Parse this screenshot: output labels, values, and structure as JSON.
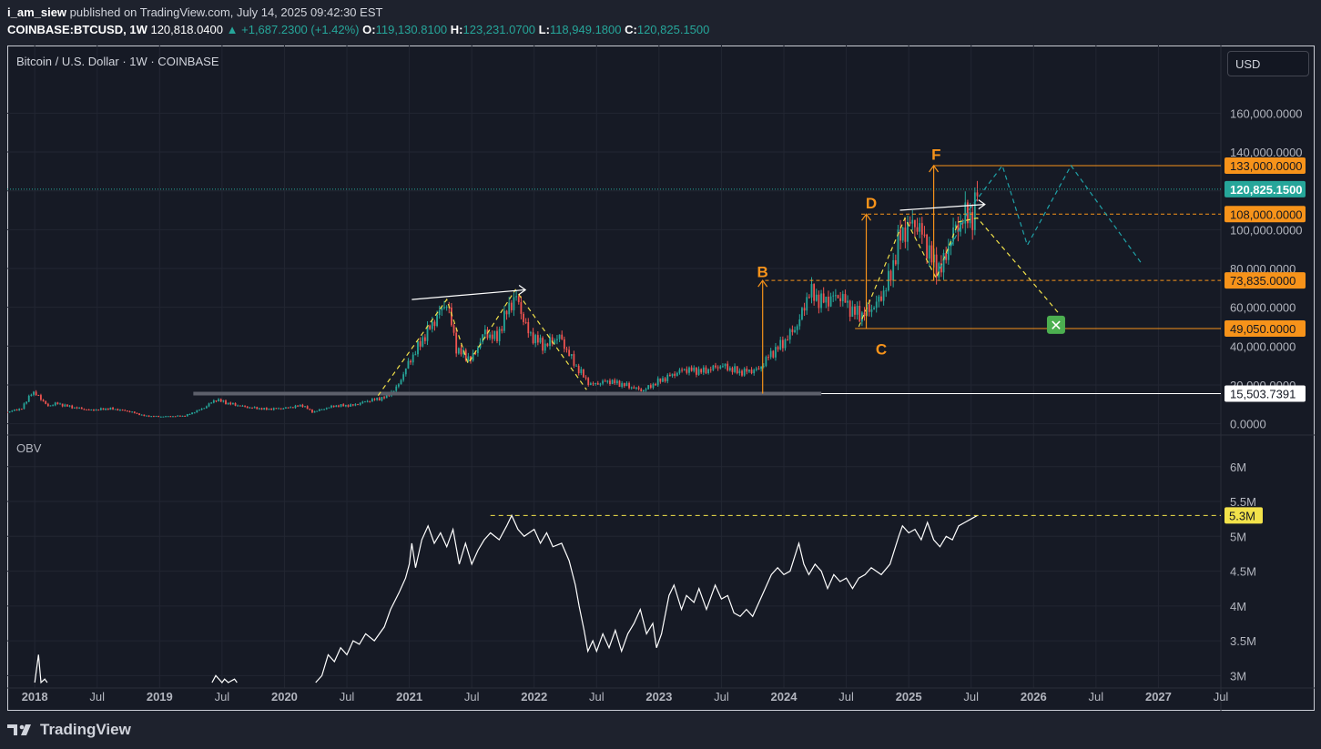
{
  "header": {
    "author": "i_am_siew",
    "published_text": "published on TradingView.com, July 14, 2025 09:42:30 EST",
    "symbol": "COINBASE:BTCUSD, 1W",
    "last": "120,818.0400",
    "change": "+1,687.2300 (+1.42%)",
    "o_label": "O:",
    "o_value": "119,130.8100",
    "h_label": "H:",
    "h_value": "123,231.0700",
    "l_label": "L:",
    "l_value": "118,949.1800",
    "c_label": "C:",
    "c_value": "120,825.1500"
  },
  "chart_title": "Bitcoin / U.S. Dollar · 1W · COINBASE",
  "currency_button": "USD",
  "obv_label": "OBV",
  "footer": {
    "brand": "TradingView"
  },
  "colors": {
    "background": "#161a25",
    "up": "#26a69a",
    "down": "#ef5350",
    "orange": "#f7931a",
    "yellow_dash": "#f2e24a",
    "teal_dash": "#1fa2a8",
    "price_tag": "#26a69a",
    "obv_tag": "#f2e24a",
    "x_box": "#4caf50"
  },
  "chart_data": [
    {
      "type": "candlestick",
      "panel": "price",
      "title": "Bitcoin / U.S. Dollar · 1W · COINBASE",
      "y_axis_ticks": [
        "160,000.0000",
        "140,000.0000",
        "120,000.0000",
        "100,000.0000",
        "80,000.0000",
        "60,000.0000",
        "40,000.0000",
        "20,000.0000",
        "0.0000"
      ],
      "y_ticks_values": [
        160000,
        140000,
        120000,
        100000,
        80000,
        60000,
        40000,
        20000,
        0
      ],
      "ylim": [
        -3000,
        178000
      ],
      "x_axis_ticks": [
        "2018",
        "Jul",
        "2019",
        "Jul",
        "2020",
        "Jul",
        "2021",
        "Jul",
        "2022",
        "Jul",
        "2023",
        "Jul",
        "2024",
        "Jul",
        "2025",
        "Jul",
        "2026",
        "Jul",
        "2027",
        "Jul"
      ],
      "x_ticks_values": [
        2018.0,
        2018.5,
        2019.0,
        2019.5,
        2020.0,
        2020.5,
        2021.0,
        2021.5,
        2022.0,
        2022.5,
        2023.0,
        2023.5,
        2024.0,
        2024.5,
        2025.0,
        2025.5,
        2026.0,
        2026.5,
        2027.0,
        2027.5
      ],
      "xlim": [
        2017.78,
        2027.5
      ],
      "price_line_value": 120825.15,
      "price_tags": [
        {
          "label": "133,000.0000",
          "value": 133000,
          "kind": "orange"
        },
        {
          "label": "120,825.1500",
          "value": 120825.15,
          "kind": "teal"
        },
        {
          "label": "108,000.0000",
          "value": 108000,
          "kind": "orange"
        },
        {
          "label": "73,835.0000",
          "value": 73835,
          "kind": "orange"
        },
        {
          "label": "49,050.0000",
          "value": 49050,
          "kind": "orange"
        },
        {
          "label": "15,503.7391",
          "value": 15503.7391,
          "kind": "white"
        }
      ],
      "levels": [
        {
          "value": 133000,
          "style": "solid",
          "color": "orange",
          "x_start": 2025.2
        },
        {
          "value": 108000,
          "style": "dashed",
          "color": "orange",
          "x_start": 2024.62
        },
        {
          "value": 73835,
          "style": "dashed",
          "color": "orange",
          "x_start": 2023.85
        },
        {
          "value": 49050,
          "style": "solid",
          "color": "orange",
          "x_start": 2024.57
        },
        {
          "value": 15503.7391,
          "style": "solid",
          "color": "white",
          "x_start": 2024.3
        },
        {
          "value": 15503.7391,
          "style": "thick-gray",
          "color": "gray",
          "x_start": 2019.27,
          "x_end": 2024.3
        }
      ],
      "pattern_points": [
        {
          "label": "B",
          "x": 2023.83,
          "y": 75500
        },
        {
          "label": "C",
          "x": 2024.78,
          "y": 45000
        },
        {
          "label": "D",
          "x": 2024.7,
          "y": 111000
        },
        {
          "label": "F",
          "x": 2025.22,
          "y": 136000
        }
      ],
      "measure_arrows": [
        {
          "x": 2023.83,
          "from": 15500,
          "to": 73835
        },
        {
          "x": 2024.66,
          "from": 49050,
          "to": 108000
        },
        {
          "x": 2025.2,
          "from": 73835,
          "to": 133000
        }
      ],
      "trend_arrows": [
        {
          "from": [
            2021.02,
            64000
          ],
          "to": [
            2021.93,
            69000
          ]
        },
        {
          "from": [
            2024.93,
            110000
          ],
          "to": [
            2025.61,
            113000
          ]
        }
      ],
      "projection_yellow": [
        [
          [
            2020.75,
            14500
          ],
          [
            2021.3,
            64000
          ],
          [
            2021.47,
            31000
          ],
          [
            2021.85,
            69000
          ],
          [
            2022.42,
            17500
          ]
        ],
        [
          [
            2024.6,
            50000
          ],
          [
            2024.97,
            106000
          ],
          [
            2025.22,
            75000
          ],
          [
            2025.4,
            104000
          ],
          [
            2025.55,
            106000
          ],
          [
            2025.95,
            76000
          ],
          [
            2026.2,
            57000
          ]
        ]
      ],
      "projection_teal": [
        [
          2025.25,
          80000
        ],
        [
          2025.48,
          110000
        ],
        [
          2025.75,
          133000
        ],
        [
          2025.95,
          92000
        ],
        [
          2026.3,
          133000
        ],
        [
          2026.86,
          83000
        ]
      ],
      "target_marker": {
        "x": 2026.18,
        "y": 51000,
        "symbol": "✕"
      },
      "weekly_closes": [
        [
          2017.78,
          6000
        ],
        [
          2017.9,
          8000
        ],
        [
          2017.97,
          16000
        ],
        [
          2018.03,
          14500
        ],
        [
          2018.1,
          9000
        ],
        [
          2018.17,
          10500
        ],
        [
          2018.3,
          8500
        ],
        [
          2018.45,
          7000
        ],
        [
          2018.6,
          7800
        ],
        [
          2018.75,
          6500
        ],
        [
          2018.88,
          4000
        ],
        [
          2019.0,
          3700
        ],
        [
          2019.2,
          4000
        ],
        [
          2019.35,
          8000
        ],
        [
          2019.45,
          12500
        ],
        [
          2019.55,
          10500
        ],
        [
          2019.7,
          8500
        ],
        [
          2019.85,
          7500
        ],
        [
          2020.0,
          8000
        ],
        [
          2020.15,
          9500
        ],
        [
          2020.22,
          6000
        ],
        [
          2020.4,
          9200
        ],
        [
          2020.55,
          9500
        ],
        [
          2020.65,
          11500
        ],
        [
          2020.8,
          13500
        ],
        [
          2020.9,
          18500
        ],
        [
          2021.0,
          32000
        ],
        [
          2021.12,
          45000
        ],
        [
          2021.25,
          58000
        ],
        [
          2021.3,
          63000
        ],
        [
          2021.38,
          38000
        ],
        [
          2021.5,
          33000
        ],
        [
          2021.6,
          47000
        ],
        [
          2021.7,
          44000
        ],
        [
          2021.8,
          61000
        ],
        [
          2021.86,
          65000
        ],
        [
          2021.95,
          47000
        ],
        [
          2022.08,
          40000
        ],
        [
          2022.2,
          45000
        ],
        [
          2022.33,
          30000
        ],
        [
          2022.45,
          20000
        ],
        [
          2022.6,
          22000
        ],
        [
          2022.75,
          19500
        ],
        [
          2022.87,
          17000
        ],
        [
          2023.0,
          22000
        ],
        [
          2023.2,
          28000
        ],
        [
          2023.35,
          27000
        ],
        [
          2023.5,
          30000
        ],
        [
          2023.65,
          26500
        ],
        [
          2023.8,
          28000
        ],
        [
          2023.88,
          35000
        ],
        [
          2024.0,
          42000
        ],
        [
          2024.12,
          52000
        ],
        [
          2024.2,
          68000
        ],
        [
          2024.3,
          63000
        ],
        [
          2024.45,
          66000
        ],
        [
          2024.55,
          58000
        ],
        [
          2024.62,
          56000
        ],
        [
          2024.75,
          62000
        ],
        [
          2024.85,
          75000
        ],
        [
          2024.92,
          95000
        ],
        [
          2024.97,
          100000
        ],
        [
          2025.05,
          104000
        ],
        [
          2025.12,
          96000
        ],
        [
          2025.2,
          82000
        ],
        [
          2025.27,
          80000
        ],
        [
          2025.33,
          95000
        ],
        [
          2025.4,
          103000
        ],
        [
          2025.47,
          108000
        ],
        [
          2025.52,
          106000
        ],
        [
          2025.55,
          120825
        ]
      ]
    },
    {
      "type": "line",
      "panel": "OBV",
      "title": "OBV",
      "y_axis_ticks": [
        "6M",
        "5.5M",
        "5M",
        "4.5M",
        "4M",
        "3.5M",
        "3M"
      ],
      "y_ticks_values": [
        6,
        5.5,
        5,
        4.5,
        4,
        3.5,
        3
      ],
      "ylim": [
        2.9,
        6.35
      ],
      "last_value_label": "5.3M",
      "last_value": 5.3,
      "resistance_dashed": {
        "value": 5.3,
        "x_start": 2021.65
      },
      "series": [
        {
          "x_y_millions": [
            [
              2018.0,
              2.8
            ],
            [
              2018.03,
              3.3
            ],
            [
              2018.05,
              2.9
            ],
            [
              2018.08,
              2.95
            ],
            [
              2018.1,
              2.8
            ],
            [
              2019.42,
              2.9
            ],
            [
              2019.45,
              3.0
            ],
            [
              2019.5,
              2.9
            ],
            [
              2019.52,
              2.95
            ],
            [
              2019.55,
              2.85
            ],
            [
              2019.6,
              2.95
            ],
            [
              2019.62,
              2.8
            ],
            [
              2020.25,
              2.8
            ],
            [
              2020.3,
              3.0
            ],
            [
              2020.35,
              3.3
            ],
            [
              2020.4,
              3.2
            ],
            [
              2020.45,
              3.4
            ],
            [
              2020.5,
              3.3
            ],
            [
              2020.55,
              3.5
            ],
            [
              2020.6,
              3.45
            ],
            [
              2020.65,
              3.6
            ],
            [
              2020.72,
              3.5
            ],
            [
              2020.8,
              3.7
            ],
            [
              2020.85,
              3.95
            ],
            [
              2020.92,
              4.2
            ],
            [
              2020.97,
              4.4
            ],
            [
              2021.0,
              4.6
            ],
            [
              2021.02,
              4.9
            ],
            [
              2021.05,
              4.55
            ],
            [
              2021.1,
              4.95
            ],
            [
              2021.15,
              5.15
            ],
            [
              2021.2,
              4.9
            ],
            [
              2021.25,
              5.05
            ],
            [
              2021.3,
              4.85
            ],
            [
              2021.35,
              5.1
            ],
            [
              2021.4,
              4.6
            ],
            [
              2021.45,
              4.9
            ],
            [
              2021.5,
              4.6
            ],
            [
              2021.55,
              4.8
            ],
            [
              2021.6,
              4.95
            ],
            [
              2021.65,
              5.05
            ],
            [
              2021.72,
              4.95
            ],
            [
              2021.78,
              5.15
            ],
            [
              2021.82,
              5.3
            ],
            [
              2021.87,
              5.1
            ],
            [
              2021.92,
              5.0
            ],
            [
              2022.0,
              5.1
            ],
            [
              2022.05,
              4.9
            ],
            [
              2022.1,
              5.05
            ],
            [
              2022.15,
              4.85
            ],
            [
              2022.22,
              4.9
            ],
            [
              2022.28,
              4.65
            ],
            [
              2022.33,
              4.3
            ],
            [
              2022.36,
              4.0
            ],
            [
              2022.4,
              3.65
            ],
            [
              2022.43,
              3.35
            ],
            [
              2022.47,
              3.5
            ],
            [
              2022.5,
              3.35
            ],
            [
              2022.55,
              3.6
            ],
            [
              2022.6,
              3.4
            ],
            [
              2022.65,
              3.65
            ],
            [
              2022.7,
              3.35
            ],
            [
              2022.75,
              3.6
            ],
            [
              2022.8,
              3.75
            ],
            [
              2022.85,
              3.95
            ],
            [
              2022.9,
              3.6
            ],
            [
              2022.95,
              3.75
            ],
            [
              2022.98,
              3.4
            ],
            [
              2023.02,
              3.6
            ],
            [
              2023.08,
              4.15
            ],
            [
              2023.12,
              4.3
            ],
            [
              2023.18,
              3.95
            ],
            [
              2023.22,
              4.15
            ],
            [
              2023.28,
              4.05
            ],
            [
              2023.32,
              4.25
            ],
            [
              2023.38,
              3.95
            ],
            [
              2023.45,
              4.3
            ],
            [
              2023.5,
              4.1
            ],
            [
              2023.55,
              4.15
            ],
            [
              2023.6,
              3.9
            ],
            [
              2023.65,
              3.85
            ],
            [
              2023.7,
              3.95
            ],
            [
              2023.75,
              3.85
            ],
            [
              2023.8,
              4.05
            ],
            [
              2023.85,
              4.25
            ],
            [
              2023.9,
              4.45
            ],
            [
              2023.95,
              4.55
            ],
            [
              2024.0,
              4.45
            ],
            [
              2024.05,
              4.5
            ],
            [
              2024.12,
              4.9
            ],
            [
              2024.16,
              4.6
            ],
            [
              2024.2,
              4.45
            ],
            [
              2024.25,
              4.6
            ],
            [
              2024.3,
              4.5
            ],
            [
              2024.35,
              4.25
            ],
            [
              2024.4,
              4.45
            ],
            [
              2024.45,
              4.35
            ],
            [
              2024.5,
              4.4
            ],
            [
              2024.55,
              4.25
            ],
            [
              2024.6,
              4.4
            ],
            [
              2024.65,
              4.45
            ],
            [
              2024.7,
              4.55
            ],
            [
              2024.78,
              4.45
            ],
            [
              2024.85,
              4.6
            ],
            [
              2024.92,
              5.0
            ],
            [
              2024.95,
              5.15
            ],
            [
              2025.0,
              5.05
            ],
            [
              2025.05,
              5.1
            ],
            [
              2025.1,
              4.95
            ],
            [
              2025.15,
              5.2
            ],
            [
              2025.2,
              4.95
            ],
            [
              2025.25,
              4.85
            ],
            [
              2025.3,
              5.0
            ],
            [
              2025.35,
              4.95
            ],
            [
              2025.4,
              5.15
            ],
            [
              2025.45,
              5.2
            ],
            [
              2025.5,
              5.25
            ],
            [
              2025.55,
              5.3
            ]
          ]
        }
      ],
      "x_axis_ticks": [
        "2018",
        "Jul",
        "2019",
        "Jul",
        "2020",
        "Jul",
        "2021",
        "Jul",
        "2022",
        "Jul",
        "2023",
        "Jul",
        "2024",
        "Jul",
        "2025",
        "Jul",
        "2026",
        "Jul",
        "2027",
        "Jul"
      ]
    }
  ]
}
